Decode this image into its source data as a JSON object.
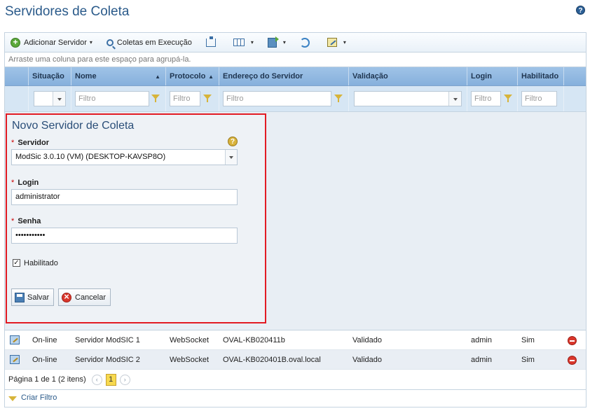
{
  "page": {
    "title": "Servidores de Coleta"
  },
  "toolbar": {
    "add_server": "Adicionar Servidor",
    "running_collections": "Coletas em Execução"
  },
  "grid": {
    "group_hint": "Arraste uma coluna para este espaço para agrupá-la.",
    "columns": {
      "situacao": "Situação",
      "nome": "Nome",
      "protocolo": "Protocolo",
      "endereco": "Endereço do Servidor",
      "validacao": "Validação",
      "login": "Login",
      "habilitado": "Habilitado"
    },
    "filter_placeholder": "Filtro",
    "rows": [
      {
        "situacao": "On-line",
        "nome": "Servidor ModSIC 1",
        "protocolo": "WebSocket",
        "endereco": "OVAL-KB020411b",
        "validacao": "Validado",
        "login": "admin",
        "habilitado": "Sim"
      },
      {
        "situacao": "On-line",
        "nome": "Servidor ModSIC 2",
        "protocolo": "WebSocket",
        "endereco": "OVAL-KB020401B.oval.local",
        "validacao": "Validado",
        "login": "admin",
        "habilitado": "Sim"
      }
    ],
    "pager": {
      "summary": "Página 1 de 1 (2 itens)",
      "current_page": "1",
      "prev": "‹",
      "next": "›"
    },
    "create_filter": "Criar Filtro"
  },
  "form": {
    "title": "Novo Servidor de Coleta",
    "required_mark": "*",
    "server_label": "Servidor",
    "server_value": "ModSic 3.0.10 (VM) (DESKTOP-KAVSP8O)",
    "login_label": "Login",
    "login_value": "administrator",
    "password_label": "Senha",
    "password_value": "•••••••••••",
    "enabled_label": "Habilitado",
    "enabled_check": "✓",
    "save": "Salvar",
    "cancel": "Cancelar"
  },
  "icons": {
    "help": "?",
    "dropdown_caret": "▾",
    "sort_asc": "▲"
  }
}
